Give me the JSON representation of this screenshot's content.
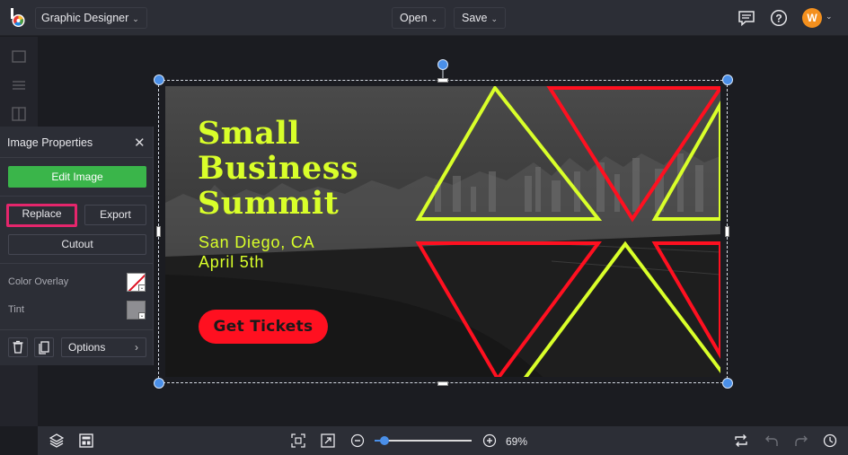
{
  "topbar": {
    "app_name": "Graphic Designer",
    "open_label": "Open",
    "save_label": "Save",
    "avatar_initial": "W"
  },
  "panel": {
    "title": "Image Properties",
    "edit_image": "Edit Image",
    "replace": "Replace",
    "export": "Export",
    "cutout": "Cutout",
    "color_overlay": "Color Overlay",
    "tint": "Tint",
    "options": "Options"
  },
  "design": {
    "headline": [
      "Small",
      "Business",
      "Summit"
    ],
    "location": "San Diego, CA",
    "date": "April 5th",
    "cta": "Get Tickets"
  },
  "bottombar": {
    "zoom_value": "69%",
    "zoom_fraction": 0.1
  },
  "colors": {
    "accent_green": "#3ab54a",
    "highlight_pink": "#e5266c",
    "brand_yellow": "#d9ff2a",
    "brand_red": "#ff1020",
    "selection_blue": "#4a8fe8"
  }
}
